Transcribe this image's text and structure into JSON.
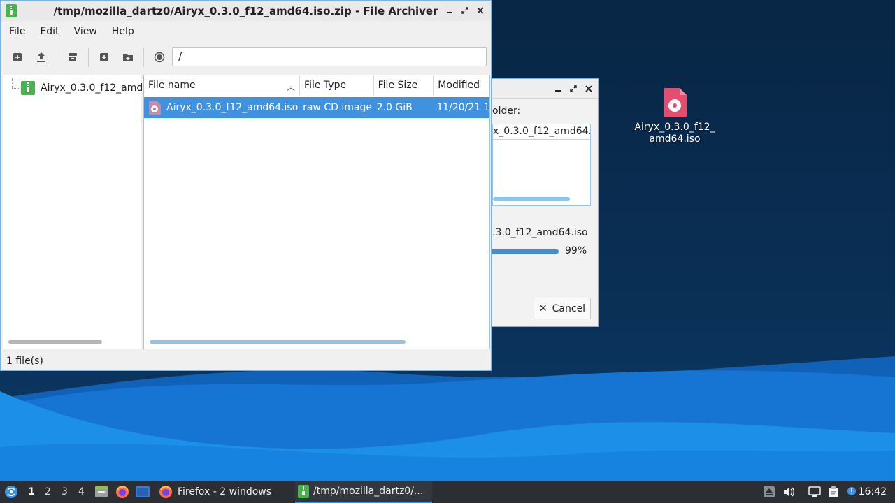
{
  "desktop": {
    "icon_label": "Airyx_0.3.0_f12_\namd64.iso"
  },
  "dialog": {
    "folder_label": "older:",
    "folder_value": "x_0.3.0_f12_amd64.i",
    "current_file": ".3.0_f12_amd64.iso",
    "progress_percent": 99,
    "percent_text": "99%",
    "cancel_label": "Cancel"
  },
  "window": {
    "title": "/tmp/mozilla_dartz0/Airyx_0.3.0_f12_amd64.iso.zip - File Archiver",
    "menu": [
      "File",
      "Edit",
      "View",
      "Help"
    ],
    "location": "/",
    "tree_item": "Airyx_0.3.0_f12_amd",
    "columns": {
      "name": "File name",
      "type": "File Type",
      "size": "File Size",
      "modified": "Modified"
    },
    "files": [
      {
        "name": "Airyx_0.3.0_f12_amd64.iso",
        "type": "raw CD image",
        "size": "2.0 GiB",
        "modified": "11/20/21 1:"
      }
    ],
    "status": "1 file(s)"
  },
  "taskbar": {
    "workspaces": [
      "1",
      "2",
      "3",
      "4"
    ],
    "active_workspace": "1",
    "tasks": [
      {
        "label": "Firefox - 2 windows"
      },
      {
        "label": "/tmp/mozilla_dartz0/..."
      }
    ],
    "clock": "16:42"
  },
  "colors": {
    "selection": "#3e92e0",
    "desktop_dark": "#0a2f55",
    "wave_light": "#1c8fe8",
    "taskbar": "#2b2f34"
  }
}
